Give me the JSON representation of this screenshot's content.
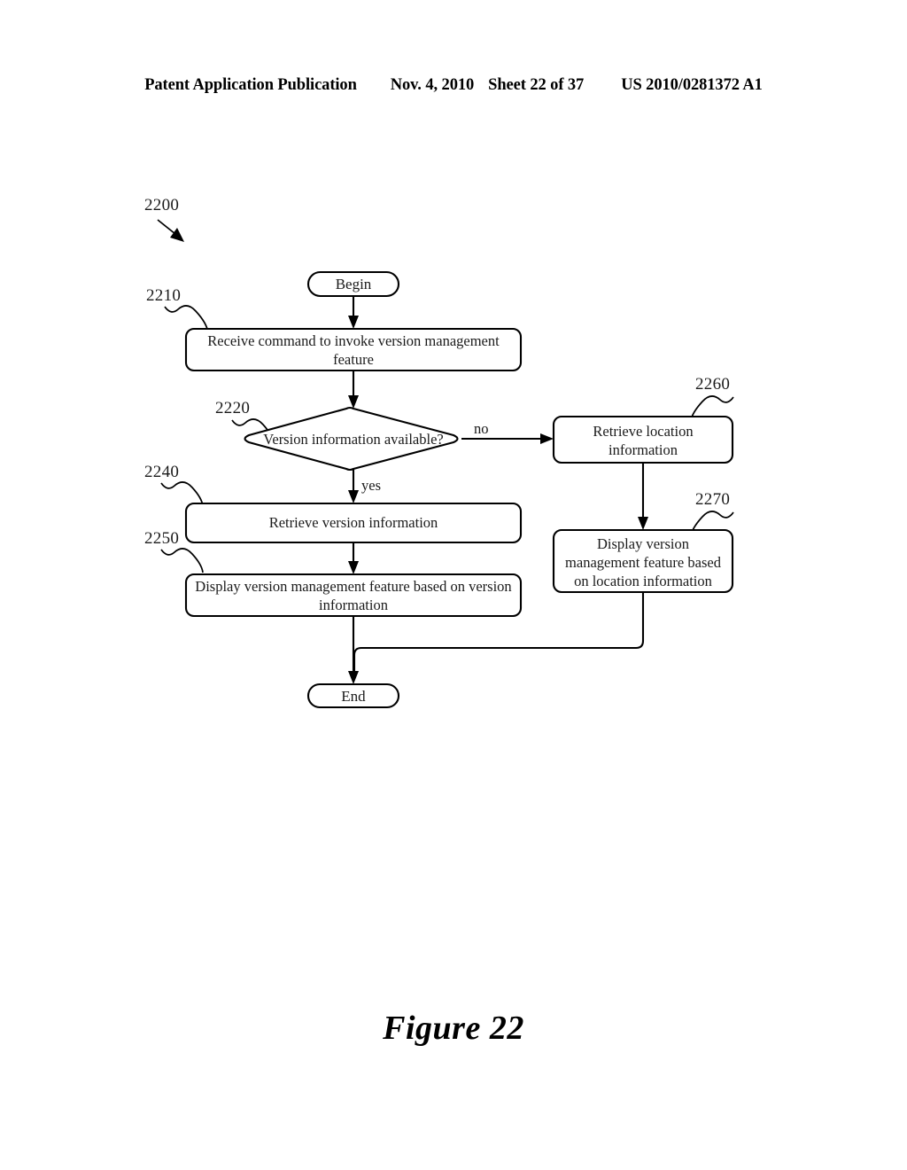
{
  "header": {
    "publication": "Patent Application Publication",
    "date": "Nov. 4, 2010",
    "sheet": "Sheet 22 of 37",
    "document_number": "US 2010/0281372 A1"
  },
  "figure": {
    "caption": "Figure 22",
    "diagram_reference": "2200"
  },
  "flowchart": {
    "type": "flowchart",
    "terminals": {
      "begin": "Begin",
      "end": "End"
    },
    "nodes": [
      {
        "ref": "2210",
        "shape": "process",
        "text": "Receive command to invoke version management\nfeature"
      },
      {
        "ref": "2220",
        "shape": "decision",
        "text": "Version information available?"
      },
      {
        "ref": "2240",
        "shape": "process",
        "text": "Retrieve version information"
      },
      {
        "ref": "2250",
        "shape": "process",
        "text": "Display version management feature based on version\ninformation"
      },
      {
        "ref": "2260",
        "shape": "process",
        "text": "Retrieve location\ninformation"
      },
      {
        "ref": "2270",
        "shape": "process",
        "text": "Display version\nmanagement feature based\non location information"
      }
    ],
    "edge_labels": {
      "no": "no",
      "yes": "yes"
    }
  },
  "colors": {
    "ink": "#000000",
    "paper": "#ffffff"
  }
}
